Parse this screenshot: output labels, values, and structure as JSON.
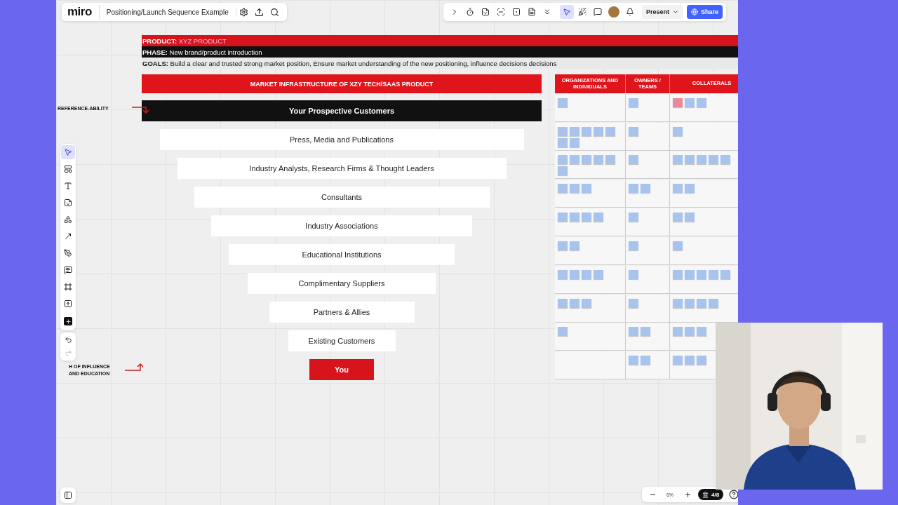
{
  "app": {
    "logo": "miro",
    "board_title": "Positioning/Launch Sequence Example"
  },
  "top_tools": [
    {
      "selected": false
    },
    {
      "selected": false
    },
    {
      "selected": false
    },
    {
      "selected": false
    },
    {
      "selected": false
    },
    {
      "selected": false
    },
    {
      "selected": false
    },
    {
      "selected": true
    },
    {
      "selected": false
    }
  ],
  "present_button": "Present",
  "share_button": "Share",
  "header": {
    "product_label": "PRODUCT:",
    "product": "XYZ PRODUCT",
    "phase_label": "PHASE:",
    "phase": "New brand/product introduction",
    "goals_label": "GOALS:",
    "goals": "Build a clear and trusted strong market position, Ensure market understanding of the new positioning, influence decisions decisions"
  },
  "funnel": {
    "title": "MARKET INFRASTRUCTURE OF XZY TECH/SAAS PRODUCT",
    "levels": [
      {
        "label": "Your Prospective Customers",
        "kind": "top"
      },
      {
        "label": "Press, Media and Publications",
        "kind": "plain"
      },
      {
        "label": "Industry Analysts, Research Firms & Thought Leaders",
        "kind": "plain"
      },
      {
        "label": "Consultants",
        "kind": "plain"
      },
      {
        "label": "Industry Associations",
        "kind": "plain"
      },
      {
        "label": "Educational Institutions",
        "kind": "plain"
      },
      {
        "label": "Complimentary Suppliers",
        "kind": "plain"
      },
      {
        "label": "Partners & Allies",
        "kind": "plain"
      },
      {
        "label": "Existing Customers",
        "kind": "plain"
      },
      {
        "label": "You",
        "kind": "bottom"
      }
    ]
  },
  "annotations": {
    "top": "REFERENCE-ABILITY",
    "bottom": "H OF INFLUENCE AND EDUCATION"
  },
  "matrix": {
    "columns": [
      "ORGANIZATIONS AND INDIVIDUALS",
      "OWNERS / TEAMS",
      "COLLATERALS"
    ]
  },
  "left_tools": [
    {
      "selected": true
    },
    {
      "selected": false
    },
    {
      "selected": false
    },
    {
      "selected": false
    },
    {
      "selected": false
    },
    {
      "selected": false
    },
    {
      "selected": false
    },
    {
      "selected": false
    },
    {
      "selected": false
    },
    {
      "selected": false
    }
  ],
  "zoom": {
    "level_text": "6%",
    "pages": "4/8"
  }
}
